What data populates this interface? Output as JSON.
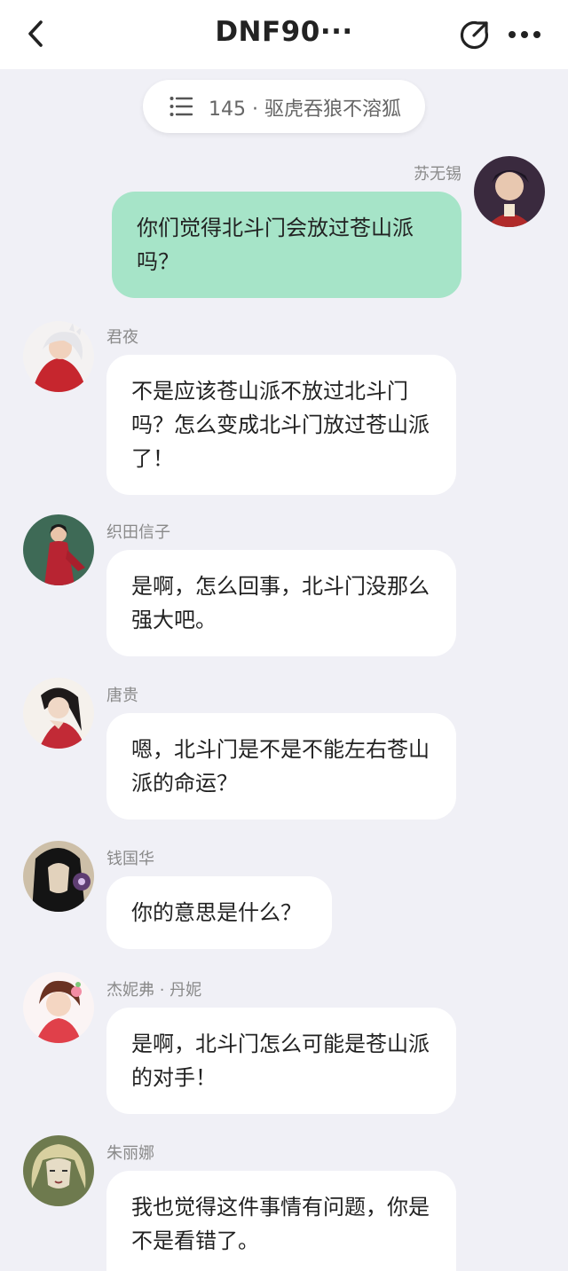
{
  "header": {
    "title": "DNF90···"
  },
  "chapter": {
    "label": "145 · 驱虎吞狼不溶狐"
  },
  "messages": [
    {
      "name": "苏无锡",
      "text": "你们觉得北斗门会放过苍山派吗？",
      "side": "right"
    },
    {
      "name": "君夜",
      "text": "不是应该苍山派不放过北斗门吗？怎么变成北斗门放过苍山派了！",
      "side": "left"
    },
    {
      "name": "织田信子",
      "text": "是啊，怎么回事，北斗门没那么强大吧。",
      "side": "left"
    },
    {
      "name": "唐贵",
      "text": "嗯，北斗门是不是不能左右苍山派的命运？",
      "side": "left"
    },
    {
      "name": "钱国华",
      "text": "你的意思是什么？",
      "side": "left"
    },
    {
      "name": "杰妮弗 · 丹妮",
      "text": "是啊，北斗门怎么可能是苍山派的对手！",
      "side": "left"
    },
    {
      "name": "朱丽娜",
      "text": "我也觉得这件事情有问题，你是不是看错了。",
      "side": "left"
    }
  ],
  "colors": {
    "background": "#f0f0f6",
    "my_bubble": "#a6e4c8",
    "other_bubble": "#ffffff"
  }
}
